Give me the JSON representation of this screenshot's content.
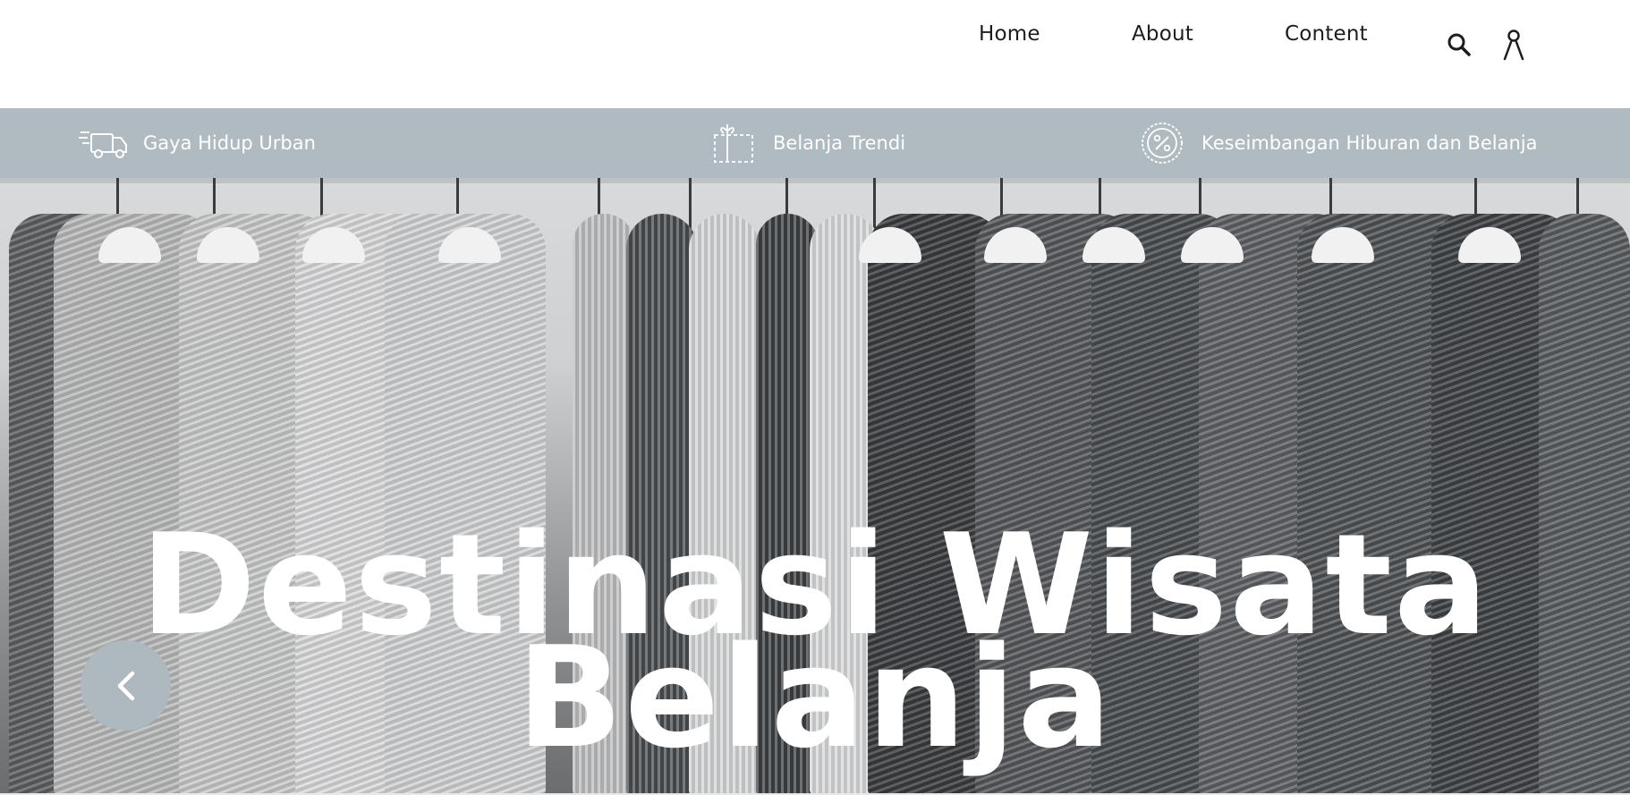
{
  "nav": {
    "items": [
      {
        "label": "Home"
      },
      {
        "label": "About"
      },
      {
        "label": "Content"
      }
    ],
    "search_icon": "search-icon",
    "user_icon": "user-icon"
  },
  "features": [
    {
      "icon": "delivery-truck-icon",
      "label": "Gaya Hidup Urban"
    },
    {
      "icon": "gift-voucher-icon",
      "label": "Belanja Trendi"
    },
    {
      "icon": "discount-badge-icon",
      "label": "Keseimbangan Hiburan dan Belanja"
    }
  ],
  "hero": {
    "title_line1": "Destinasi Wisata",
    "title_line2": "Belanja",
    "prev_icon": "chevron-left-icon"
  },
  "colors": {
    "strip_bg": "#afbbc1",
    "prev_button_bg": "#adb8bf",
    "hero_text": "#ffffff"
  }
}
